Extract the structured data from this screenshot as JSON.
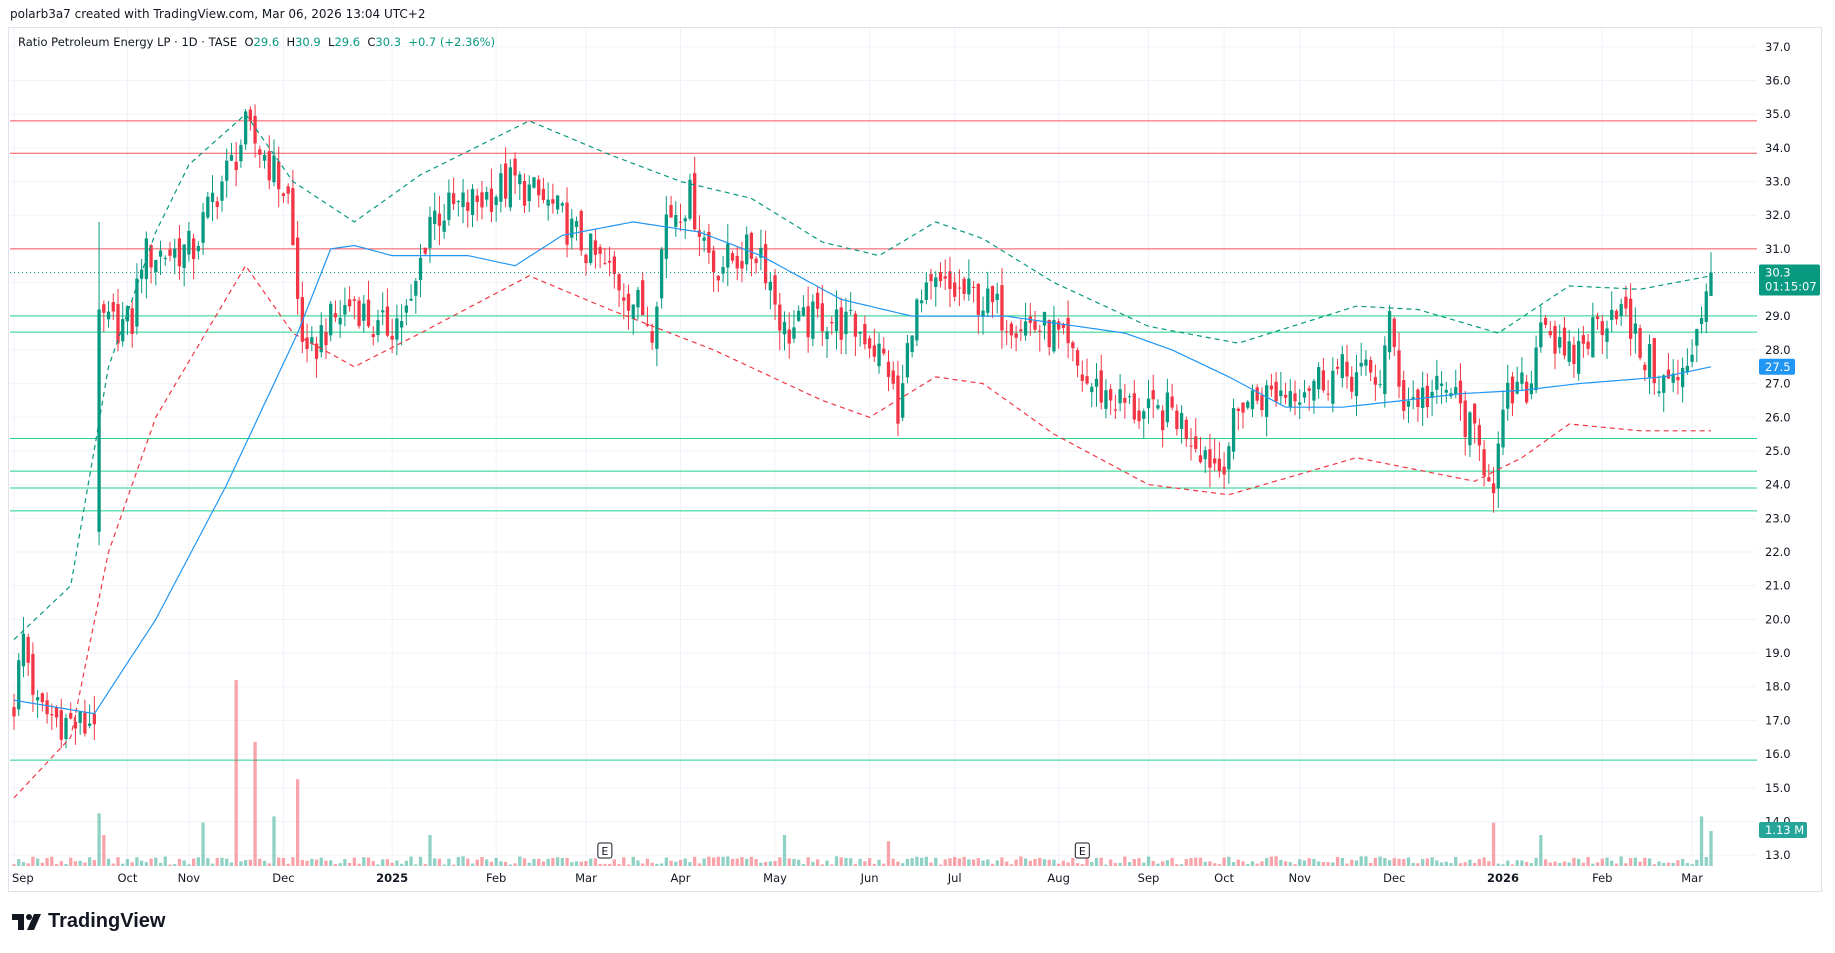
{
  "credit": "polarb3a7 created with TradingView.com, Mar 06, 2026 13:04 UTC+2",
  "legend": {
    "symbol": "Ratio Petroleum Energy LP · 1D · TASE",
    "o_label": "O",
    "o": "29.6",
    "h_label": "H",
    "h": "30.9",
    "l_label": "L",
    "l": "29.6",
    "c_label": "C",
    "c": "30.3",
    "change": "+0.7 (+2.36%)"
  },
  "logo": "TradingView",
  "colors": {
    "up": "#089981",
    "down": "#f23645",
    "ma": "#2196f3",
    "band_up": "#089981",
    "band_down": "#f23645",
    "hline_red": "#f7525f",
    "hline_green": "#22d38a"
  },
  "chart_data": {
    "type": "candlestick",
    "ylim": [
      13,
      37
    ],
    "y_ticks": [
      "37.0",
      "36.0",
      "35.0",
      "34.0",
      "33.0",
      "32.0",
      "31.0",
      "30.0",
      "29.0",
      "28.0",
      "27.0",
      "26.0",
      "25.0",
      "24.0",
      "23.0",
      "22.0",
      "21.0",
      "20.0",
      "19.0",
      "18.0",
      "17.0",
      "16.0",
      "15.0",
      "14.0",
      "13.0"
    ],
    "bar_count": 360,
    "x_ticks": [
      {
        "i": 0,
        "label": "Sep"
      },
      {
        "i": 24,
        "label": "Oct"
      },
      {
        "i": 37,
        "label": "Nov"
      },
      {
        "i": 57,
        "label": "Dec"
      },
      {
        "i": 80,
        "label": "2025",
        "bold": true
      },
      {
        "i": 102,
        "label": "Feb"
      },
      {
        "i": 121,
        "label": "Mar"
      },
      {
        "i": 141,
        "label": "Apr"
      },
      {
        "i": 161,
        "label": "May"
      },
      {
        "i": 181,
        "label": "Jun"
      },
      {
        "i": 199,
        "label": "Jul"
      },
      {
        "i": 221,
        "label": "Aug"
      },
      {
        "i": 240,
        "label": "Sep"
      },
      {
        "i": 256,
        "label": "Oct"
      },
      {
        "i": 272,
        "label": "Nov"
      },
      {
        "i": 292,
        "label": "Dec"
      },
      {
        "i": 315,
        "label": "2026",
        "bold": true
      },
      {
        "i": 336,
        "label": "Feb"
      },
      {
        "i": 355,
        "label": "Mar"
      }
    ],
    "close_anchors": [
      [
        0,
        17.5
      ],
      [
        2,
        19.5
      ],
      [
        5,
        17.3
      ],
      [
        10,
        17.0
      ],
      [
        15,
        16.8
      ],
      [
        17,
        17.2
      ],
      [
        18,
        29
      ],
      [
        20,
        28.7
      ],
      [
        25,
        28.8
      ],
      [
        27,
        30.8
      ],
      [
        38,
        31
      ],
      [
        42,
        32.5
      ],
      [
        46,
        33.5
      ],
      [
        49,
        34.5
      ],
      [
        53,
        33.8
      ],
      [
        58,
        32.5
      ],
      [
        60,
        29.5
      ],
      [
        62,
        27.5
      ],
      [
        65,
        28.5
      ],
      [
        72,
        29.5
      ],
      [
        77,
        28.5
      ],
      [
        84,
        29.2
      ],
      [
        88,
        32
      ],
      [
        96,
        32.3
      ],
      [
        106,
        33
      ],
      [
        114,
        32.2
      ],
      [
        121,
        31
      ],
      [
        128,
        30
      ],
      [
        135,
        28.8
      ],
      [
        138,
        32
      ],
      [
        143,
        32.5
      ],
      [
        148,
        30.5
      ],
      [
        158,
        31
      ],
      [
        163,
        28.5
      ],
      [
        171,
        29
      ],
      [
        180,
        28.5
      ],
      [
        185,
        27.5
      ],
      [
        187,
        25.8
      ],
      [
        190,
        29
      ],
      [
        195,
        29.8
      ],
      [
        203,
        29.6
      ],
      [
        210,
        29
      ],
      [
        220,
        28.5
      ],
      [
        227,
        27
      ],
      [
        240,
        26
      ],
      [
        245,
        26.2
      ],
      [
        255,
        24.5
      ],
      [
        260,
        26.5
      ],
      [
        269,
        26.8
      ],
      [
        279,
        27.3
      ],
      [
        289,
        27.2
      ],
      [
        291,
        28.7
      ],
      [
        294,
        26.5
      ],
      [
        304,
        26.8
      ],
      [
        310,
        25
      ],
      [
        313,
        24.2
      ],
      [
        316,
        26.5
      ],
      [
        321,
        27
      ],
      [
        323,
        29.3
      ],
      [
        328,
        27.5
      ],
      [
        334,
        28.6
      ],
      [
        339,
        29.4
      ],
      [
        344,
        28
      ],
      [
        349,
        27
      ],
      [
        354,
        27.2
      ],
      [
        356,
        28.8
      ],
      [
        359,
        30.3
      ]
    ],
    "last_bar": {
      "o": 29.6,
      "h": 30.9,
      "l": 29.6,
      "c": 30.3,
      "v": 1.13
    },
    "volume_base_m": 0.15,
    "volume_spikes": [
      [
        18,
        1.7
      ],
      [
        19,
        1.0
      ],
      [
        47,
        6.0
      ],
      [
        51,
        4.0
      ],
      [
        55,
        1.6
      ],
      [
        60,
        2.8
      ],
      [
        40,
        1.4
      ],
      [
        88,
        1.0
      ],
      [
        163,
        1.0
      ],
      [
        185,
        0.8
      ],
      [
        313,
        1.4
      ],
      [
        323,
        1.0
      ],
      [
        357,
        1.6
      ]
    ],
    "ma": {
      "name": "MA",
      "anchors": [
        [
          0,
          17.6
        ],
        [
          17,
          17.2
        ],
        [
          30,
          20
        ],
        [
          45,
          24
        ],
        [
          60,
          28.5
        ],
        [
          67,
          31
        ],
        [
          72,
          31.1
        ],
        [
          80,
          30.8
        ],
        [
          96,
          30.8
        ],
        [
          106,
          30.5
        ],
        [
          116,
          31.4
        ],
        [
          131,
          31.8
        ],
        [
          145,
          31.5
        ],
        [
          158,
          30.8
        ],
        [
          175,
          29.5
        ],
        [
          190,
          29
        ],
        [
          210,
          29
        ],
        [
          220,
          28.8
        ],
        [
          235,
          28.5
        ],
        [
          245,
          28.0
        ],
        [
          257,
          27.2
        ],
        [
          269,
          26.3
        ],
        [
          281,
          26.3
        ],
        [
          294,
          26.5
        ],
        [
          306,
          26.7
        ],
        [
          319,
          26.8
        ],
        [
          331,
          27.0
        ],
        [
          349,
          27.2
        ],
        [
          359,
          27.5
        ]
      ],
      "last_label": "27.5"
    },
    "band_upper": [
      [
        0,
        19.4
      ],
      [
        12,
        21
      ],
      [
        20,
        27.5
      ],
      [
        30,
        31.5
      ],
      [
        37,
        33.5
      ],
      [
        49,
        35
      ],
      [
        59,
        33
      ],
      [
        72,
        31.8
      ],
      [
        86,
        33.2
      ],
      [
        109,
        34.8
      ],
      [
        126,
        33.8
      ],
      [
        141,
        33
      ],
      [
        156,
        32.5
      ],
      [
        171,
        31.2
      ],
      [
        183,
        30.8
      ],
      [
        195,
        31.8
      ],
      [
        205,
        31.3
      ],
      [
        220,
        30
      ],
      [
        240,
        28.7
      ],
      [
        259,
        28.2
      ],
      [
        284,
        29.3
      ],
      [
        297,
        29.2
      ],
      [
        314,
        28.5
      ],
      [
        329,
        29.9
      ],
      [
        344,
        29.8
      ],
      [
        359,
        30.2
      ]
    ],
    "band_lower": [
      [
        0,
        14.7
      ],
      [
        12,
        16.5
      ],
      [
        20,
        22
      ],
      [
        30,
        26
      ],
      [
        49,
        30.5
      ],
      [
        59,
        28.5
      ],
      [
        72,
        27.5
      ],
      [
        86,
        28.5
      ],
      [
        109,
        30.2
      ],
      [
        126,
        29.2
      ],
      [
        148,
        28
      ],
      [
        171,
        26.5
      ],
      [
        181,
        26
      ],
      [
        195,
        27.2
      ],
      [
        205,
        27.0
      ],
      [
        220,
        25.5
      ],
      [
        240,
        24
      ],
      [
        257,
        23.7
      ],
      [
        284,
        24.8
      ],
      [
        309,
        24.1
      ],
      [
        319,
        24.8
      ],
      [
        329,
        25.8
      ],
      [
        344,
        25.6
      ],
      [
        359,
        25.6
      ]
    ],
    "hlines_red": [
      34.8,
      33.84,
      31.0
    ],
    "hlines_green": [
      29.01,
      28.53,
      25.37,
      24.4,
      23.9,
      23.22,
      15.82
    ],
    "last_price_label": "30.3",
    "countdown": "01:15:07",
    "volume_label": "1.13 M",
    "earnings_markers": [
      {
        "i": 125,
        "label": "E"
      },
      {
        "i": 226,
        "label": "E"
      }
    ]
  }
}
